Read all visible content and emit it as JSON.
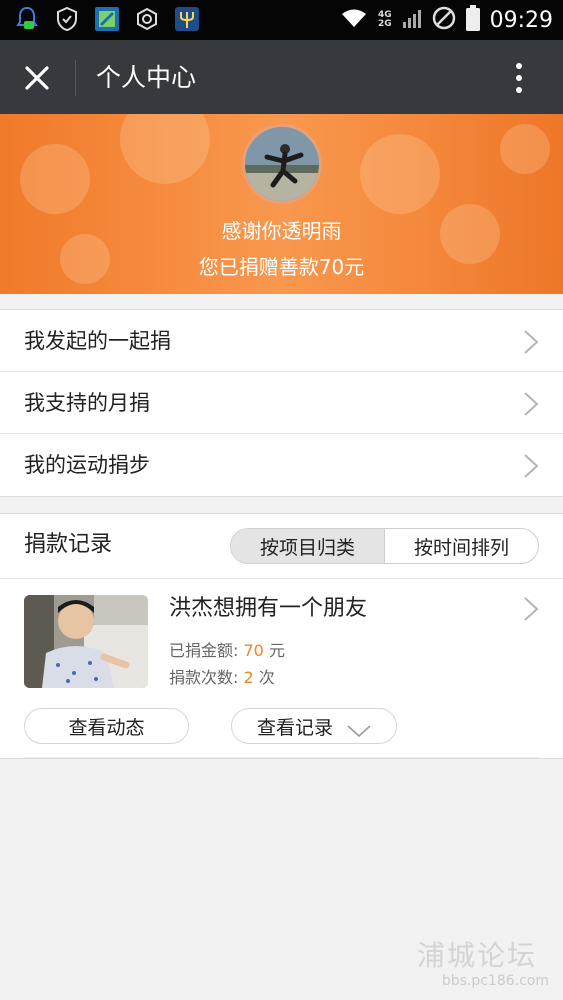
{
  "status_bar": {
    "icons": [
      "notification-icon",
      "shield-icon",
      "app-icon",
      "settings-icon",
      "trident-icon"
    ],
    "network_top": "4G",
    "network_bottom": "2G",
    "time": "09:29"
  },
  "header": {
    "title": "个人中心",
    "close_icon": "close-icon",
    "more_icon": "more-vertical-icon"
  },
  "profile": {
    "thanks_text": "感谢你透明雨",
    "donated_text": "您已捐赠善款70元"
  },
  "menu": {
    "items": [
      {
        "label": "我发起的一起捐"
      },
      {
        "label": "我支持的月捐"
      },
      {
        "label": "我的运动捐步"
      }
    ]
  },
  "records": {
    "title": "捐款记录",
    "tabs": [
      {
        "label": "按项目归类",
        "active": true
      },
      {
        "label": "按时间排列",
        "active": false
      }
    ],
    "project": {
      "title": "洪杰想拥有一个朋友",
      "amount_label": "已捐金额:",
      "amount_value": "70",
      "amount_unit": "元",
      "count_label": "捐款次数:",
      "count_value": "2",
      "count_unit": "次",
      "view_updates": "查看动态",
      "view_records": "查看记录"
    }
  },
  "watermark": {
    "name": "浦城论坛",
    "url": "bbs.pc186.com"
  },
  "colors": {
    "accent": "#f0861f",
    "title_bar": "#36393e",
    "banner": "#f5893b"
  }
}
